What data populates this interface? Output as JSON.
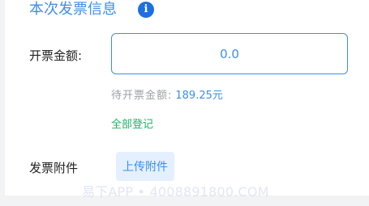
{
  "section": {
    "title": "本次发票信息",
    "info_icon": "info-icon"
  },
  "form": {
    "amount_label": "开票金额:",
    "amount_value": "0.0",
    "pending_label": "待开票金额:",
    "pending_value": "189.25元",
    "register_all_label": "全部登记",
    "attachment_label": "发票附件",
    "upload_button_label": "上传附件"
  },
  "watermark": "易下APP • 4008891800.COM",
  "colors": {
    "accent": "#3d8fe6",
    "success": "#1fb06a",
    "muted": "#9aa0a6",
    "upload_bg": "#e4f0fd"
  }
}
